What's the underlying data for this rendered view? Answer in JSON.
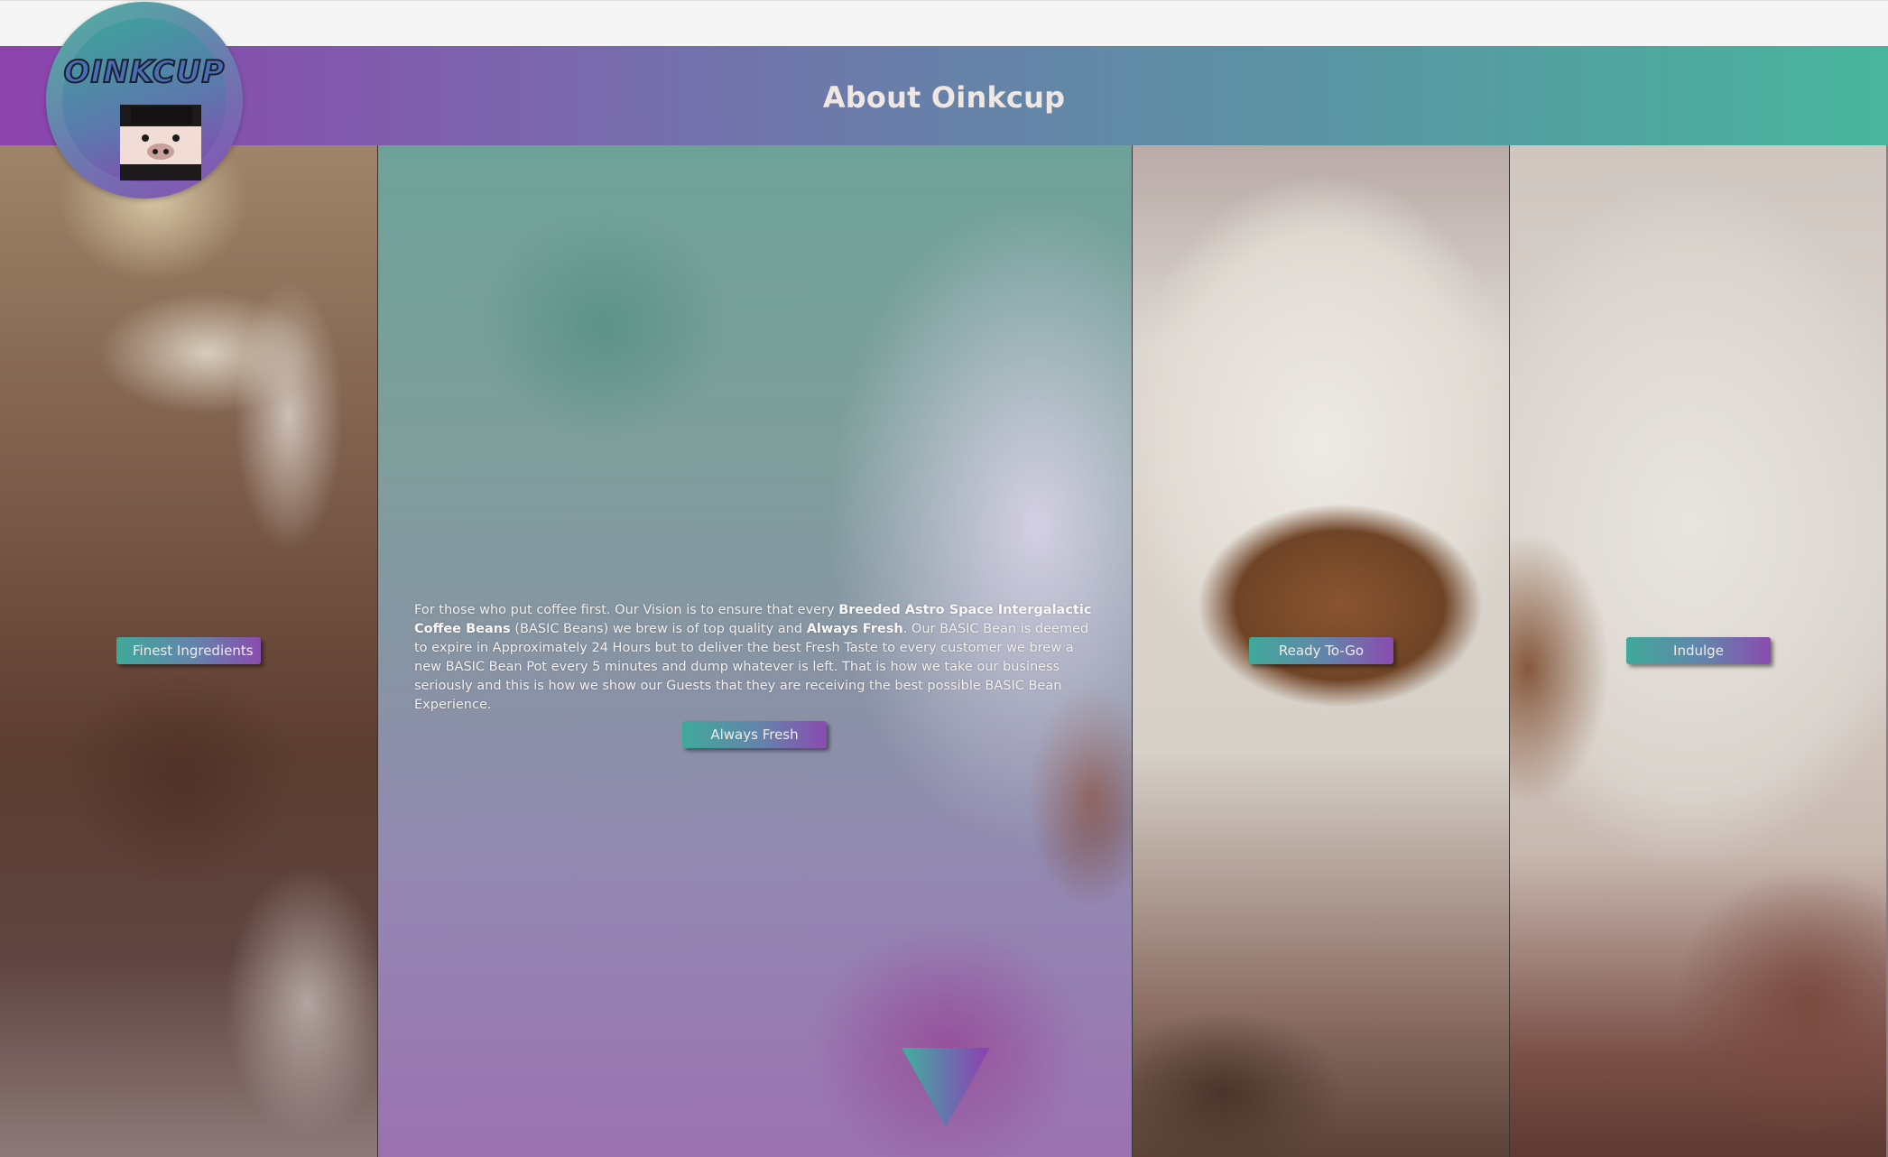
{
  "header": {
    "title": "About Oinkcup",
    "logo_text": "OINKCUP"
  },
  "panels": {
    "finest": {
      "button_label": "Finest Ingredients"
    },
    "about": {
      "text_1": "For those who put coffee first. Our Vision is to ensure that every ",
      "bold_1": "Breeded Astro Space Intergalactic Coffee Beans",
      "text_2": " (BASIC Beans) we brew is of top quality and ",
      "bold_2": "Always Fresh",
      "text_3": ". Our BASIC Bean is deemed to expire in Approximately 24 Hours but to deliver the best Fresh Taste to every customer we brew a new BASIC Bean Pot every 5 minutes and dump whatever is left. That is how we take our business seriously and this is how we show our Guests that they are receiving the best possible BASIC Bean Experience.",
      "button_label": "Always Fresh",
      "scroll_icon": "down-triangle-icon"
    },
    "ready": {
      "button_label": "Ready To-Go"
    },
    "indulge": {
      "button_label": "Indulge"
    }
  },
  "colors": {
    "gradient_start": "#8c43ad",
    "gradient_end": "#48b69c",
    "text_light": "#f0e7e2"
  }
}
